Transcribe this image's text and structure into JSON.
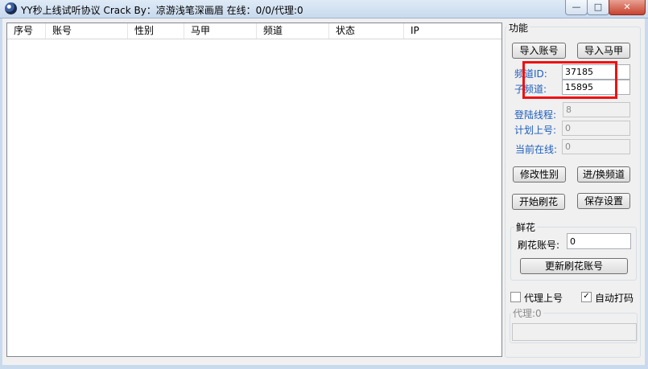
{
  "window": {
    "title": "YY秒上线试听协议 Crack By：凉游浅笔深画眉  在线：0/0/代理:0",
    "min_glyph": "—",
    "max_glyph": "□",
    "close_glyph": "✕"
  },
  "table": {
    "columns": [
      "序号",
      "账号",
      "性别",
      "马甲",
      "频道",
      "状态",
      "IP"
    ]
  },
  "panel": {
    "title": "功能",
    "import_account": "导入账号",
    "import_vest": "导入马甲",
    "channel_id_label": "频道ID:",
    "channel_id_value": "37185",
    "sub_channel_label": "子频道:",
    "sub_channel_value": "15895",
    "login_threads_label": "登陆线程:",
    "login_threads_value": "8",
    "plan_login_label": "计划上号:",
    "plan_login_value": "0",
    "online_label": "当前在线:",
    "online_value": "0",
    "modify_gender": "修改性别",
    "enter_switch_channel": "进/换频道",
    "start_flower": "开始刷花",
    "save_settings": "保存设置",
    "flower_group": "鲜花",
    "flower_account_label": "刷花账号:",
    "flower_account_value": "0",
    "update_flower_account": "更新刷花账号",
    "proxy_login_label": "代理上号",
    "proxy_login_checked": false,
    "auto_captcha_label": "自动打码",
    "auto_captcha_checked": true,
    "proxy_group": "代理:0",
    "checkmark": "✓"
  },
  "colors": {
    "highlight": "#ee1111",
    "label_blue": "#1d5dbb"
  }
}
